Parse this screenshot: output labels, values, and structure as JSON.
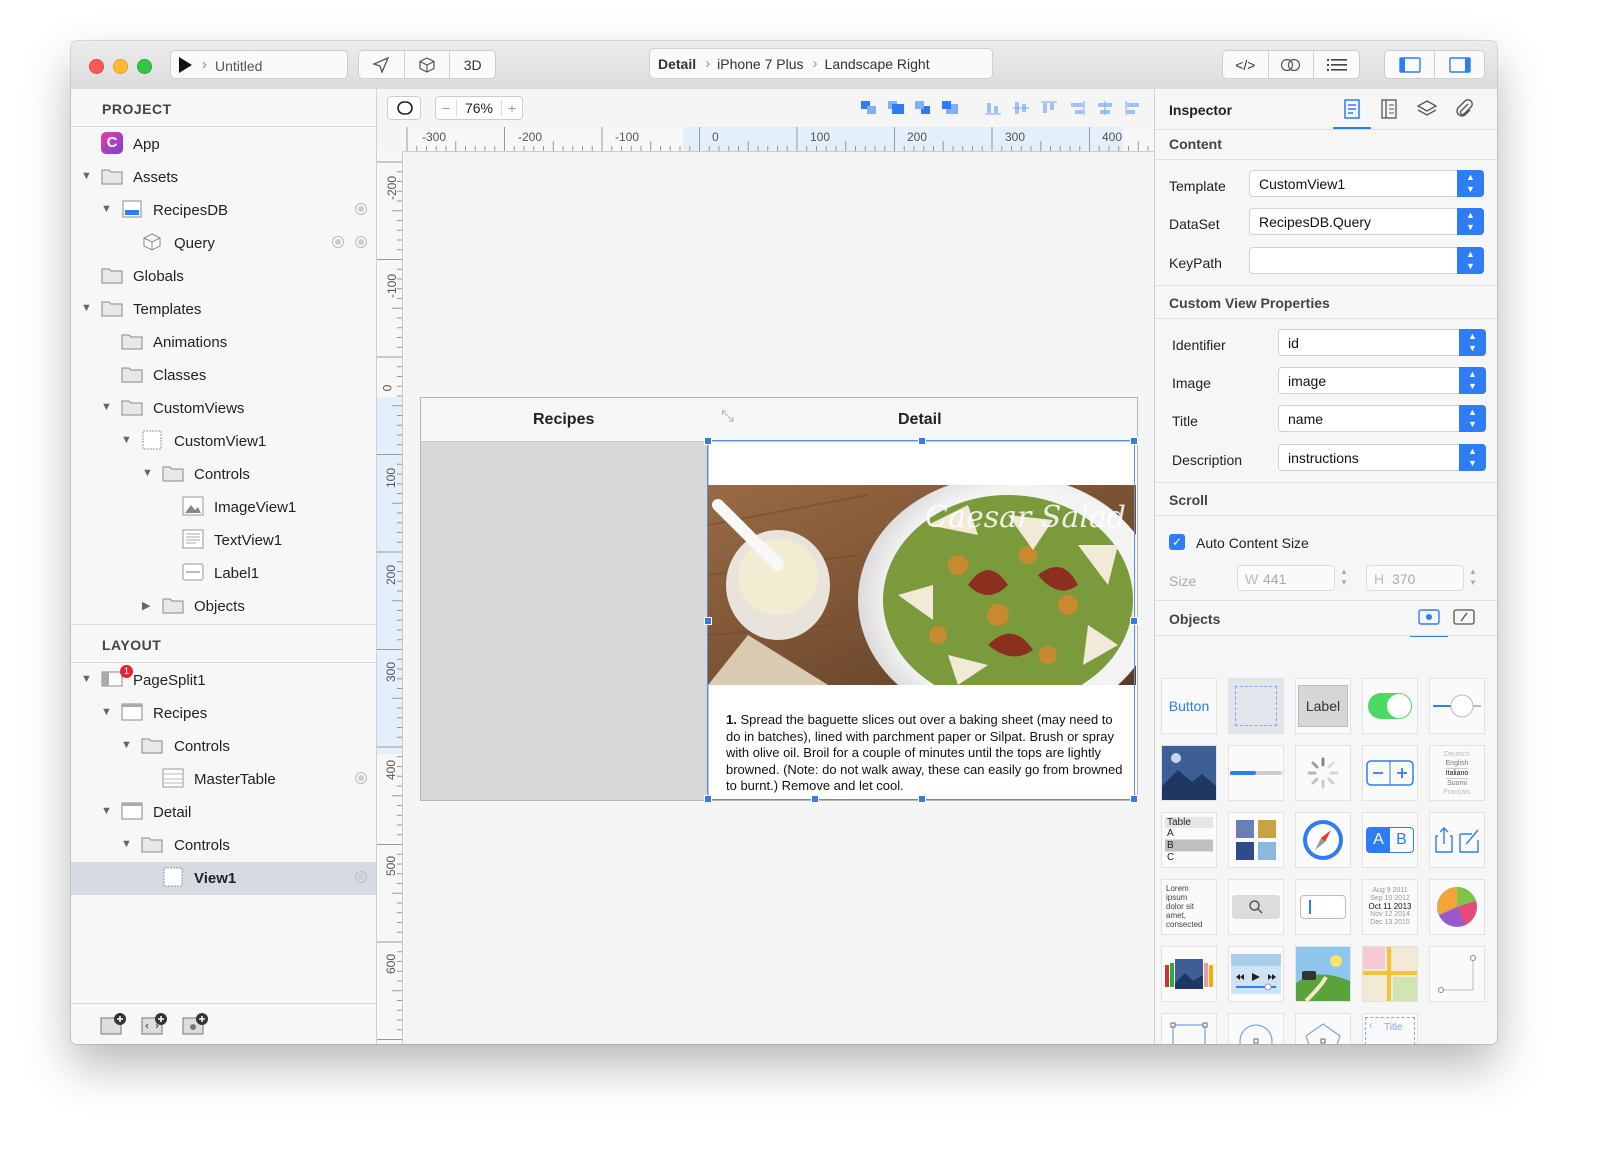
{
  "toolbar": {
    "document_title": "Untitled",
    "view_3d_label": "3D",
    "breadcrumb": [
      "Detail",
      "iPhone 7 Plus",
      "Landscape Right"
    ],
    "code_toggle_label": "</>"
  },
  "project": {
    "header": "PROJECT",
    "items": [
      {
        "label": "App"
      },
      {
        "label": "Assets"
      },
      {
        "label": "RecipesDB"
      },
      {
        "label": "Query"
      },
      {
        "label": "Globals"
      },
      {
        "label": "Templates"
      },
      {
        "label": "Animations"
      },
      {
        "label": "Classes"
      },
      {
        "label": "CustomViews"
      },
      {
        "label": "CustomView1"
      },
      {
        "label": "Controls"
      },
      {
        "label": "ImageView1"
      },
      {
        "label": "TextView1"
      },
      {
        "label": "Label1"
      },
      {
        "label": "Objects"
      }
    ]
  },
  "layout": {
    "header": "LAYOUT",
    "badge_count": "1",
    "items": [
      {
        "label": "PageSplit1"
      },
      {
        "label": "Recipes"
      },
      {
        "label": "Controls"
      },
      {
        "label": "MasterTable"
      },
      {
        "label": "Detail"
      },
      {
        "label": "Controls"
      },
      {
        "label": "View1"
      }
    ]
  },
  "canvas": {
    "zoom": "76%",
    "hruler_labels": [
      "-300",
      "-200",
      "-100",
      "0",
      "100",
      "200",
      "300",
      "400"
    ],
    "vruler_labels": [
      "-200",
      "-100",
      "0",
      "100",
      "200",
      "300",
      "400",
      "500",
      "600"
    ],
    "master_title": "Recipes",
    "detail_title": "Detail",
    "photo_title": "Caesar Salad",
    "description_num": "1.",
    "description": "Spread the baguette slices out over a baking sheet (may need to do in batches), lined with parchment paper or Silpat. Brush or spray with olive oil. Broil for a couple of minutes until the tops are lightly browned. (Note: do not walk away, these can easily go from browned to burnt.) Remove and let cool."
  },
  "inspector": {
    "title": "Inspector",
    "content_header": "Content",
    "template_label": "Template",
    "template_value": "CustomView1",
    "dataset_label": "DataSet",
    "dataset_value": "RecipesDB.Query",
    "keypath_label": "KeyPath",
    "keypath_value": "",
    "cvp_header": "Custom View Properties",
    "identifier_label": "Identifier",
    "identifier_value": "id",
    "image_label": "Image",
    "image_value": "image",
    "title_label": "Title",
    "title_value": "name",
    "description_label": "Description",
    "description_value": "instructions",
    "scroll_header": "Scroll",
    "auto_content_size_label": "Auto Content Size",
    "auto_content_size_checked": true,
    "size_label": "Size",
    "width_prefix": "W",
    "width_value": "441",
    "height_prefix": "H",
    "height_value": "370",
    "objects_header": "Objects",
    "objects": {
      "button": "Button",
      "label": "Label",
      "table": "Table",
      "table_rows": [
        "A",
        "B",
        "C"
      ],
      "segment": "AB",
      "lorem": "Lorem ipsum dolor sit amet, consected",
      "picker": [
        "Deutsch",
        "English",
        "Italiano",
        "Suomi",
        "Français"
      ],
      "date_rows": [
        "Aug 9 2011",
        "Sep 10 2012",
        "Oct 11 2013",
        "Nov 12 2014",
        "Dec 13 2015"
      ],
      "nav_title": "Title"
    }
  },
  "colors": {
    "accent": "#2e7cf6",
    "selection_row": "#d6dbe3",
    "master_bg": "#d8d8d8",
    "toggle_on": "#4cd964",
    "badge": "#e0292b"
  }
}
